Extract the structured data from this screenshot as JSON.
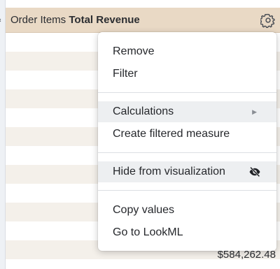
{
  "table": {
    "header_prefix": "Order Items",
    "header_bold": "Total Revenue",
    "visible_value": "$584,262.48"
  },
  "menu": {
    "items": [
      {
        "label": "Remove"
      },
      {
        "label": "Filter"
      },
      {
        "label": "Calculations",
        "has_submenu": true
      },
      {
        "label": "Create filtered measure"
      },
      {
        "label": "Hide from visualization",
        "icon": "eye-slash-icon"
      },
      {
        "label": "Copy values"
      },
      {
        "label": "Go to LookML"
      }
    ]
  },
  "colors": {
    "header_bg": "#e9d9c5",
    "row_alt_bg": "#f4f0ea",
    "menu_highlight": "#edeff1"
  }
}
